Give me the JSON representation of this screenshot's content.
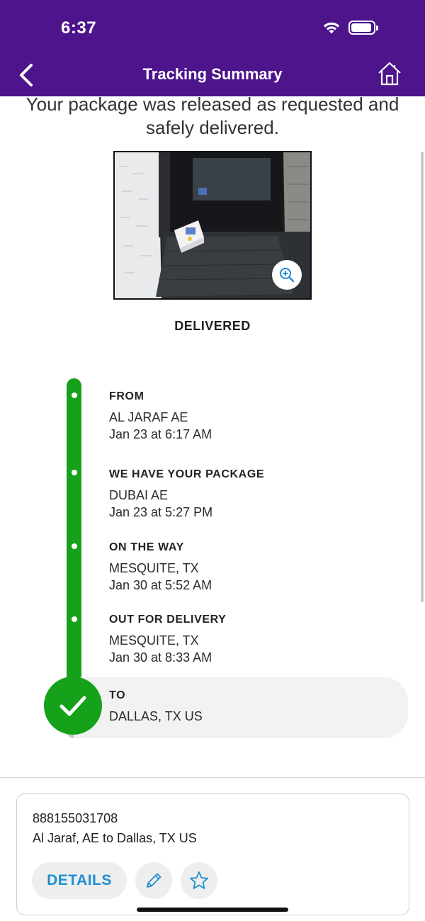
{
  "status_bar": {
    "time": "6:37",
    "icons": [
      "wifi-icon",
      "battery-icon"
    ]
  },
  "nav": {
    "title": "Tracking Summary",
    "back_icon": "chevron-left-icon",
    "home_icon": "home-icon"
  },
  "summary": {
    "message": "Your package was released as requested and safely delivered.",
    "photo": "delivery-photo-package-on-doormat",
    "zoom_icon": "zoom-in-icon",
    "status": "DELIVERED"
  },
  "timeline": {
    "steps": [
      {
        "title": "FROM",
        "location": "AL JARAF AE",
        "time": "Jan 23 at 6:17 AM"
      },
      {
        "title": "WE HAVE YOUR PACKAGE",
        "location": "DUBAI AE",
        "time": "Jan 23 at 5:27 PM"
      },
      {
        "title": "ON THE WAY",
        "location": "MESQUITE, TX",
        "time": "Jan 30 at 5:52 AM"
      },
      {
        "title": "OUT FOR DELIVERY",
        "location": "MESQUITE, TX",
        "time": "Jan 30 at 8:33 AM"
      }
    ],
    "destination": {
      "title": "TO",
      "location": "DALLAS, TX  US"
    }
  },
  "shipment_card": {
    "tracking_number": "888155031708",
    "route": "Al Jaraf, AE to Dallas, TX US",
    "details_label": "DETAILS",
    "edit_icon": "pencil-icon",
    "favorite_icon": "star-icon"
  },
  "colors": {
    "header": "#4d148c",
    "progress": "#16a11a",
    "link": "#1e8fd1"
  }
}
